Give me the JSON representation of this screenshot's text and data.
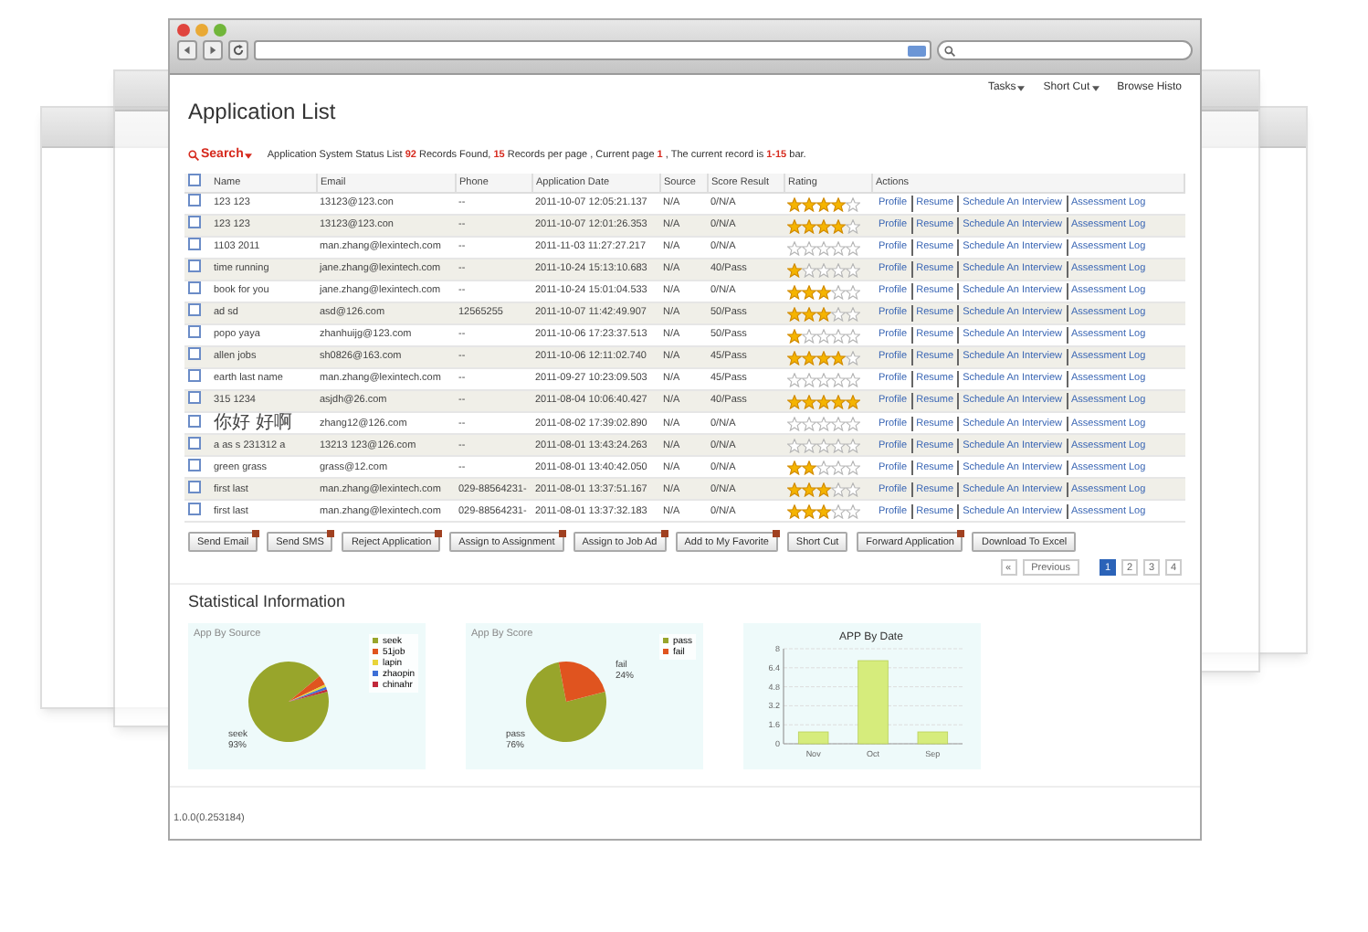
{
  "menu": [
    {
      "label": "Tasks",
      "caret": true
    },
    {
      "label": "Short Cut",
      "caret": true
    },
    {
      "label": "Browse Histo",
      "caret": false
    }
  ],
  "title": "Application List",
  "search": {
    "label": "Search"
  },
  "status_text": [
    {
      "text": "Application System Status List ",
      "highlight": false
    },
    {
      "text": "92",
      "highlight": true
    },
    {
      "text": " Records Found, ",
      "highlight": false
    },
    {
      "text": "15",
      "highlight": true
    },
    {
      "text": " Records per page , Current page ",
      "highlight": false
    },
    {
      "text": "1",
      "highlight": true
    },
    {
      "text": " , The current record is ",
      "highlight": false
    },
    {
      "text": "1-15",
      "highlight": true
    },
    {
      "text": " bar.",
      "highlight": false
    }
  ],
  "table": {
    "select_all_checked": false,
    "columns": [
      "Name",
      "Email",
      "Phone",
      "Application Date",
      "Source",
      "Score Result",
      "Rating",
      "Actions"
    ],
    "rows": [
      {
        "checked": false,
        "name": "123 123",
        "email": "13123@123.con",
        "phone": "--",
        "date": "2011-10-07 12:05:21.137",
        "source": "N/A",
        "score": "0/N/A",
        "stars": 4,
        "actions": [
          "Profile",
          "Resume",
          "Schedule An Interview",
          "Assessment Log"
        ]
      },
      {
        "checked": false,
        "name": "123 123",
        "email": "13123@123.con",
        "phone": "--",
        "date": "2011-10-07 12:01:26.353",
        "source": "N/A",
        "score": "0/N/A",
        "stars": 4,
        "actions": [
          "Profile",
          "Resume",
          "Schedule An Interview",
          "Assessment Log"
        ]
      },
      {
        "checked": false,
        "name": "1103 2011",
        "email": "man.zhang@lexintech.com",
        "phone": "--",
        "date": "2011-11-03 11:27:27.217",
        "source": "N/A",
        "score": "0/N/A",
        "stars": 0,
        "actions": [
          "Profile",
          "Resume",
          "Schedule An Interview",
          "Assessment Log"
        ]
      },
      {
        "checked": false,
        "name": "time running",
        "email": "jane.zhang@lexintech.com",
        "phone": "--",
        "date": "2011-10-24 15:13:10.683",
        "source": "N/A",
        "score": "40/Pass",
        "stars": 1,
        "actions": [
          "Profile",
          "Resume",
          "Schedule An Interview",
          "Assessment Log"
        ]
      },
      {
        "checked": false,
        "name": "book for you",
        "email": "jane.zhang@lexintech.com",
        "phone": "--",
        "date": "2011-10-24 15:01:04.533",
        "source": "N/A",
        "score": "0/N/A",
        "stars": 3,
        "actions": [
          "Profile",
          "Resume",
          "Schedule An Interview",
          "Assessment Log"
        ]
      },
      {
        "checked": false,
        "name": "ad sd",
        "email": "asd@126.com",
        "phone": "12565255",
        "date": "2011-10-07 11:42:49.907",
        "source": "N/A",
        "score": "50/Pass",
        "stars": 3,
        "actions": [
          "Profile",
          "Resume",
          "Schedule An Interview",
          "Assessment Log"
        ]
      },
      {
        "checked": false,
        "name": "popo yaya",
        "email": "zhanhuijg@123.com",
        "phone": "--",
        "date": "2011-10-06 17:23:37.513",
        "source": "N/A",
        "score": "50/Pass",
        "stars": 1,
        "actions": [
          "Profile",
          "Resume",
          "Schedule An Interview",
          "Assessment Log"
        ]
      },
      {
        "checked": false,
        "name": "allen jobs",
        "email": "sh0826@163.com",
        "phone": "--",
        "date": "2011-10-06 12:11:02.740",
        "source": "N/A",
        "score": "45/Pass",
        "stars": 4,
        "actions": [
          "Profile",
          "Resume",
          "Schedule An Interview",
          "Assessment Log"
        ]
      },
      {
        "checked": false,
        "name": "earth last name",
        "email": "man.zhang@lexintech.com",
        "phone": "--",
        "date": "2011-09-27 10:23:09.503",
        "source": "N/A",
        "score": "45/Pass",
        "stars": 0,
        "actions": [
          "Profile",
          "Resume",
          "Schedule An Interview",
          "Assessment Log"
        ]
      },
      {
        "checked": false,
        "name": "315 1234",
        "email": "asjdh@26.com",
        "phone": "--",
        "date": "2011-08-04 10:06:40.427",
        "source": "N/A",
        "score": "40/Pass",
        "stars": 5,
        "actions": [
          "Profile",
          "Resume",
          "Schedule An Interview",
          "Assessment Log"
        ]
      },
      {
        "checked": false,
        "name": "你好 好啊",
        "email": "zhang12@126.com",
        "phone": "--",
        "date": "2011-08-02 17:39:02.890",
        "source": "N/A",
        "score": "0/N/A",
        "stars": 0,
        "actions": [
          "Profile",
          "Resume",
          "Schedule An Interview",
          "Assessment Log"
        ]
      },
      {
        "checked": false,
        "name": "a as s 231312 a",
        "email": "13213 123@126.com",
        "phone": "--",
        "date": "2011-08-01 13:43:24.263",
        "source": "N/A",
        "score": "0/N/A",
        "stars": 0,
        "actions": [
          "Profile",
          "Resume",
          "Schedule An Interview",
          "Assessment Log"
        ]
      },
      {
        "checked": false,
        "name": "green grass",
        "email": "grass@12.com",
        "phone": "--",
        "date": "2011-08-01 13:40:42.050",
        "source": "N/A",
        "score": "0/N/A",
        "stars": 2,
        "actions": [
          "Profile",
          "Resume",
          "Schedule An Interview",
          "Assessment Log"
        ]
      },
      {
        "checked": false,
        "name": "first last",
        "email": "man.zhang@lexintech.com",
        "phone": "029-88564231-",
        "date": "2011-08-01 13:37:51.167",
        "source": "N/A",
        "score": "0/N/A",
        "stars": 3,
        "actions": [
          "Profile",
          "Resume",
          "Schedule An Interview",
          "Assessment Log"
        ]
      },
      {
        "checked": false,
        "name": "first last",
        "email": "man.zhang@lexintech.com",
        "phone": "029-88564231-",
        "date": "2011-08-01 13:37:32.183",
        "source": "N/A",
        "score": "0/N/A",
        "stars": 3,
        "actions": [
          "Profile",
          "Resume",
          "Schedule An Interview",
          "Assessment Log"
        ]
      }
    ]
  },
  "buttons": [
    {
      "label": "Send Email",
      "badge": true
    },
    {
      "label": "Send SMS",
      "badge": true
    },
    {
      "label": "Reject Application",
      "badge": true
    },
    {
      "label": "Assign to Assignment",
      "badge": true
    },
    {
      "label": "Assign to Job Ad",
      "badge": true
    },
    {
      "label": "Add to My Favorite",
      "badge": true
    },
    {
      "label": "Short Cut",
      "badge": false
    },
    {
      "label": "Forward Application",
      "badge": true
    },
    {
      "label": "Download To Excel",
      "badge": false
    }
  ],
  "pagination": {
    "first": "«",
    "previous": "Previous",
    "pages": [
      {
        "label": "1",
        "selected": true
      },
      {
        "label": "2",
        "selected": false
      },
      {
        "label": "3",
        "selected": false
      },
      {
        "label": "4",
        "selected": false
      }
    ]
  },
  "statistics": {
    "title": "Statistical Information",
    "charts": [
      {
        "chart_data": {
          "type": "pie",
          "title": "App By Source",
          "legend": "right",
          "categories": [
            "seek",
            "51job",
            "lapin",
            "zhaopin",
            "chinahr"
          ],
          "series": [
            {
              "values": [
                93,
                4,
                1,
                1,
                1
              ]
            }
          ],
          "colors": [
            "#98a52b",
            "#e0541f",
            "#e8d43a",
            "#3d6fd6",
            "#c0283a"
          ],
          "value_labels": [
            {
              "text": "seek",
              "pct": "93%"
            }
          ]
        }
      },
      {
        "chart_data": {
          "type": "pie",
          "title": "App By Score",
          "legend": "right",
          "categories": [
            "pass",
            "fail"
          ],
          "series": [
            {
              "values": [
                76,
                24
              ]
            }
          ],
          "colors": [
            "#98a52b",
            "#e0541f"
          ],
          "value_labels": [
            {
              "text": "pass",
              "pct": "76%"
            },
            {
              "text": "fail",
              "pct": "24%"
            }
          ]
        }
      },
      {
        "chart_data": {
          "type": "bar",
          "title": "APP By Date",
          "categories": [
            "Nov",
            "Oct",
            "Sep"
          ],
          "series": [
            {
              "color": "#d6ec7c",
              "values": [
                1,
                7,
                1
              ]
            }
          ],
          "grid": true,
          "ylim": [
            0,
            8
          ],
          "yticks": [
            0,
            1.6,
            3.2,
            4.8,
            6.4,
            8
          ]
        }
      }
    ]
  },
  "footer": "1.0.0(0.253184)"
}
